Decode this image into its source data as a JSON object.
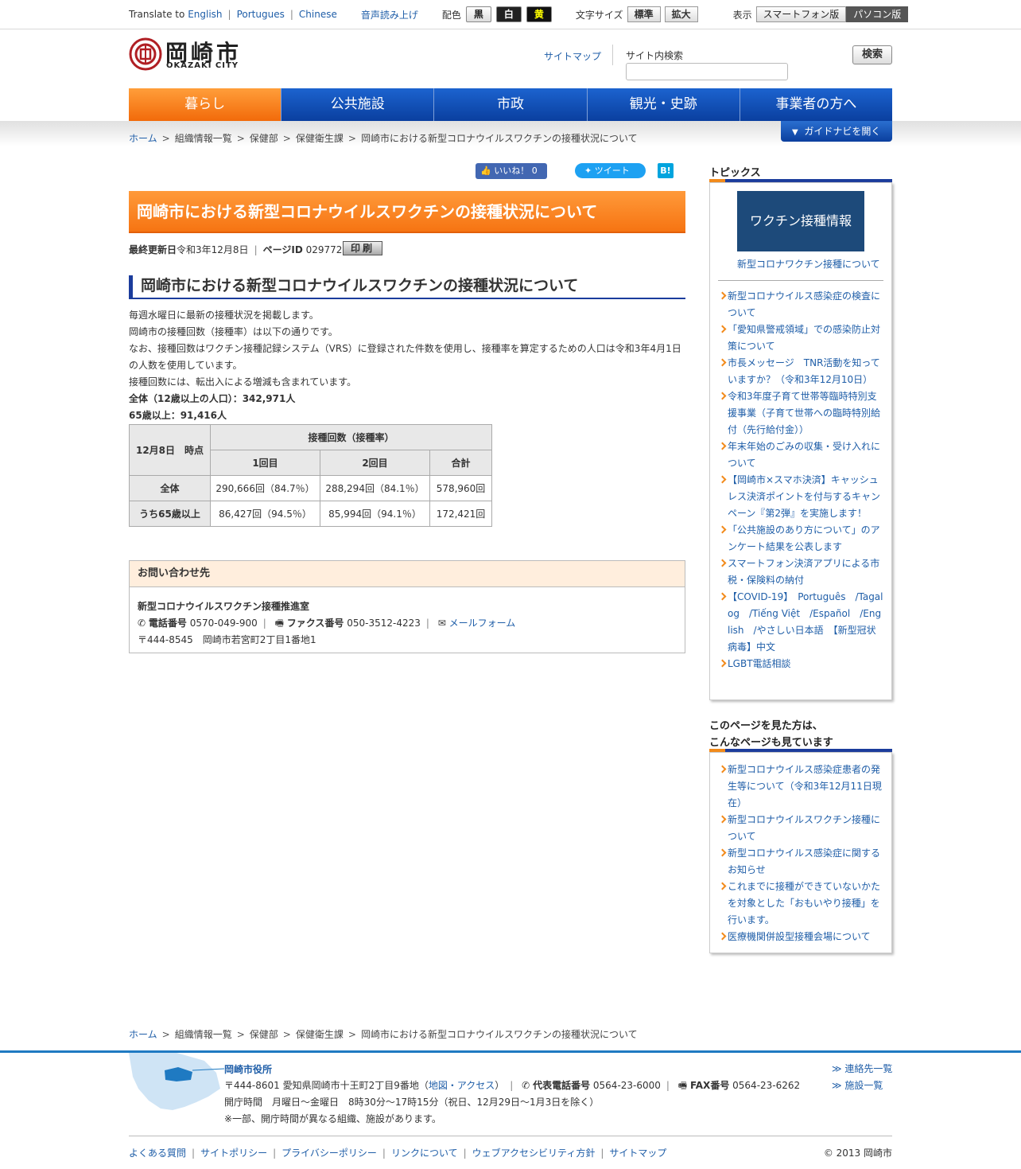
{
  "util": {
    "translate_prefix": "Translate to",
    "languages": [
      "English",
      "Portugues",
      "Chinese"
    ],
    "voice": "音声読み上げ",
    "color_label": "配色",
    "color_black": "黒",
    "color_white": "白",
    "color_yellow": "黄",
    "fontsize_label": "文字サイズ",
    "fontsize_normal": "標準",
    "fontsize_large": "拡大",
    "display_label": "表示",
    "display_sp": "スマートフォン版",
    "display_pc": "パソコン版"
  },
  "header": {
    "logo_main": "岡崎市",
    "logo_sub": "OKAZAKI CITY",
    "sitemap": "サイトマップ",
    "search_label": "サイト内検索",
    "search_value": "",
    "search_button": "検索"
  },
  "nav": [
    "暮らし",
    "公共施設",
    "市政",
    "観光・史跡",
    "事業者の方へ"
  ],
  "guide_button": "ガイドナビを開く",
  "breadcrumb": [
    "ホーム",
    "組織情報一覧",
    "保健部",
    "保健衛生課",
    "岡崎市における新型コロナウイルスワクチンの接種状況について"
  ],
  "social": {
    "like": "いいね！",
    "like_count": "0",
    "tweet": "ツイート",
    "hatena": "B!"
  },
  "page": {
    "title": "岡崎市における新型コロナウイルスワクチンの接種状況について",
    "updated_label": "最終更新日",
    "updated": "令和3年12月8日",
    "pageid_label": "ページID",
    "pageid": "029772",
    "print": "印刷",
    "h2": "岡崎市における新型コロナウイルスワクチンの接種状況について",
    "p1": "毎週水曜日に最新の接種状況を掲載します。",
    "p2": "岡崎市の接種回数（接種率）は以下の通りです。",
    "p3": "なお、接種回数はワクチン接種記録システム（VRS）に登録された件数を使用し、接種率を算定するための人口は令和3年4月1日の人数を使用しています。",
    "p4": "接種回数には、転出入による増減も含まれています。",
    "p5": "全体（12歳以上の人口）：342,971人",
    "p6": "65歳以上：91,416人"
  },
  "table": {
    "corner": "12月8日　時点",
    "group": "接種回数（接種率）",
    "cols": [
      "1回目",
      "2回目",
      "合計"
    ],
    "rows": [
      {
        "label": "全体",
        "c1": "290,666回（84.7％）",
        "c2": "288,294回（84.1％）",
        "c3": "578,960回"
      },
      {
        "label": "うち65歳以上",
        "c1": "86,427回（94.5％）",
        "c2": "85,994回（94.1％）",
        "c3": "172,421回"
      }
    ]
  },
  "contact": {
    "heading": "お問い合わせ先",
    "dept": "新型コロナウイルスワクチン接種推進室",
    "tel_label": "電話番号",
    "tel": "0570-049-900",
    "fax_label": "ファクス番号",
    "fax": "050-3512-4223",
    "mail": "メールフォーム",
    "address": "〒444-8545　岡崎市若宮町2丁目1番地1"
  },
  "topics": {
    "heading": "トピックス",
    "banner": "ワクチン接種情報",
    "banner_link": "新型コロナワクチン接種について",
    "items": [
      "新型コロナウイルス感染症の検査について",
      "「愛知県警戒領域」での感染防止対策について",
      "市長メッセージ　TNR活動を知っていますか？（令和3年12月10日）",
      "令和3年度子育て世帯等臨時特別支援事業（子育て世帯への臨時特別給付（先行給付金））",
      "年末年始のごみの収集・受け入れについて",
      "【岡崎市×スマホ決済】キャッシュレス決済ポイントを付与するキャンペーン『第2弾』を実施します！",
      "「公共施設のあり方について」のアンケート結果を公表します",
      "スマートフォン決済アプリによる市税・保険料の納付",
      "【COVID-19】　Português　/Tagalog　/Tiếng Việt　/Español　/English　/やさしい日本語　【新型冠状病毒】中文",
      "LGBT電話相談"
    ]
  },
  "related": {
    "heading1": "このページを見た方は、",
    "heading2": "こんなページも見ています",
    "items": [
      "新型コロナウイルス感染症患者の発生等について（令和3年12月11日現在）",
      "新型コロナウイルスワクチン接種について",
      "新型コロナウイルス感染症に関するお知らせ",
      "これまでに接種ができていないかたを対象とした「おもいやり接種」を行います。",
      "医療機関併設型接種会場について"
    ]
  },
  "footer": {
    "office": "岡崎市役所",
    "address": "〒444-8601 愛知県岡崎市十王町2丁目9番地",
    "map_link": "地図・アクセス",
    "tel_label": "代表電話番号",
    "tel": "0564-23-6000",
    "fax_label": "FAX番号",
    "fax": "0564-23-6262",
    "hours": "開庁時間　月曜日～金曜日　8時30分～17時15分（祝日、12月29日～1月3日を除く）",
    "note": "※一部、開庁時間が異なる組織、施設があります。",
    "contacts": "連絡先一覧",
    "facilities": "施設一覧",
    "links": [
      "よくある質問",
      "サイトポリシー",
      "プライバシーポリシー",
      "リンクについて",
      "ウェブアクセシビリティ方針",
      "サイトマップ"
    ],
    "copyright": "© 2013 岡崎市"
  },
  "colors": {
    "accent_orange": "#f67412",
    "nav_blue": "#0a3f9f",
    "link": "#1f5ea8"
  }
}
